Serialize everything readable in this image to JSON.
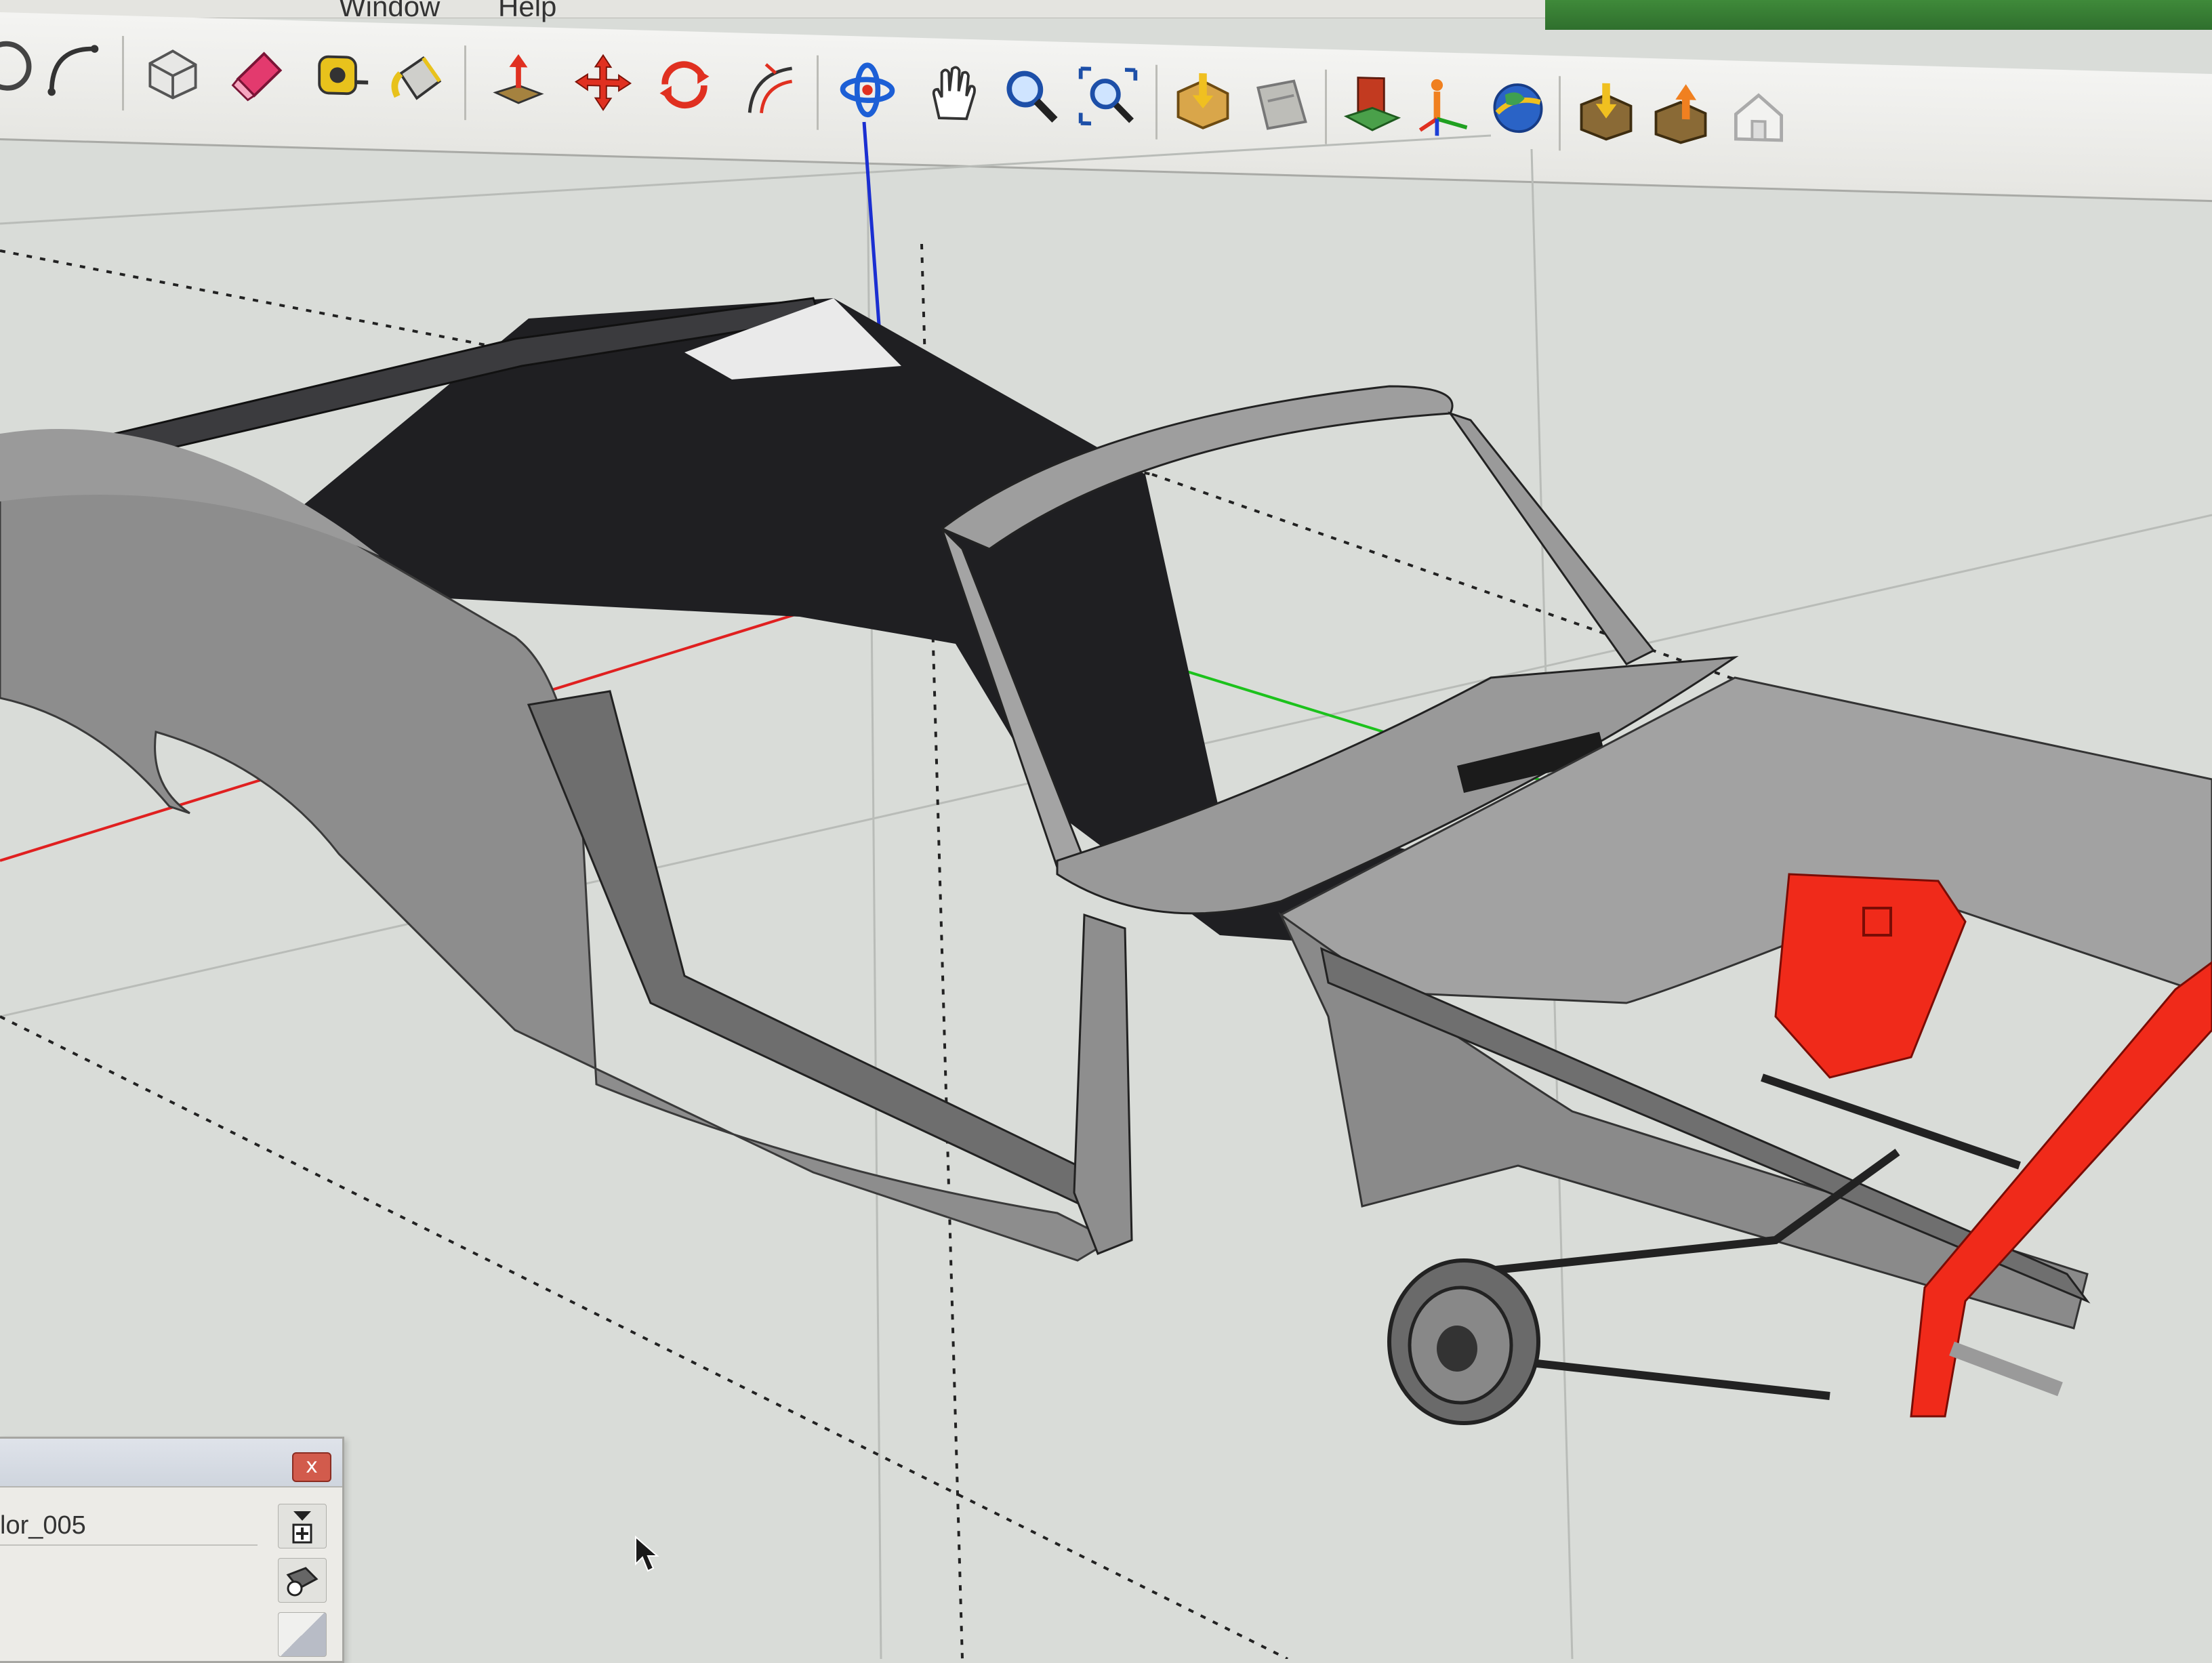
{
  "app": {
    "menu": [
      "Window",
      "Help"
    ]
  },
  "toolbar": {
    "tools": [
      {
        "name": "circle-tool",
        "icon": "circle-icon"
      },
      {
        "name": "arc-tool",
        "icon": "arc-icon"
      },
      {
        "name": "make-component-tool",
        "icon": "component-box-icon"
      },
      {
        "name": "eraser-tool",
        "icon": "eraser-icon"
      },
      {
        "name": "tape-measure-tool",
        "icon": "tape-measure-icon"
      },
      {
        "name": "paint-bucket-tool",
        "icon": "paint-bucket-icon"
      },
      {
        "name": "push-pull-tool",
        "icon": "push-pull-icon"
      },
      {
        "name": "move-tool",
        "icon": "move-icon"
      },
      {
        "name": "rotate-tool",
        "icon": "rotate-icon"
      },
      {
        "name": "offset-tool",
        "icon": "offset-icon"
      },
      {
        "name": "orbit-tool",
        "icon": "orbit-icon"
      },
      {
        "name": "pan-tool",
        "icon": "hand-icon"
      },
      {
        "name": "zoom-tool",
        "icon": "magnifier-icon"
      },
      {
        "name": "zoom-extents-tool",
        "icon": "zoom-extents-icon"
      },
      {
        "name": "get-models-tool",
        "icon": "get-models-icon"
      },
      {
        "name": "share-model-tool",
        "icon": "share-model-icon"
      },
      {
        "name": "extension-warehouse-tool",
        "icon": "warehouse-icon"
      },
      {
        "name": "position-camera-tool",
        "icon": "position-camera-icon"
      },
      {
        "name": "google-earth-tool",
        "icon": "globe-icon"
      },
      {
        "name": "get-photo-texture-tool",
        "icon": "download-box-icon"
      },
      {
        "name": "share-component-tool",
        "icon": "upload-box-icon"
      },
      {
        "name": "building-maker-tool",
        "icon": "house-icon"
      }
    ]
  },
  "materials_panel": {
    "close_label": "x",
    "material_name": "lor_005"
  },
  "colors": {
    "background": "#d9dcd8",
    "body_gray": "#8d8d8d",
    "interior_dark": "#1f1f22",
    "accent_red": "#f02a1a",
    "axis_red": "#e02020",
    "axis_green": "#1cc21c",
    "axis_blue": "#1b2fd1"
  }
}
